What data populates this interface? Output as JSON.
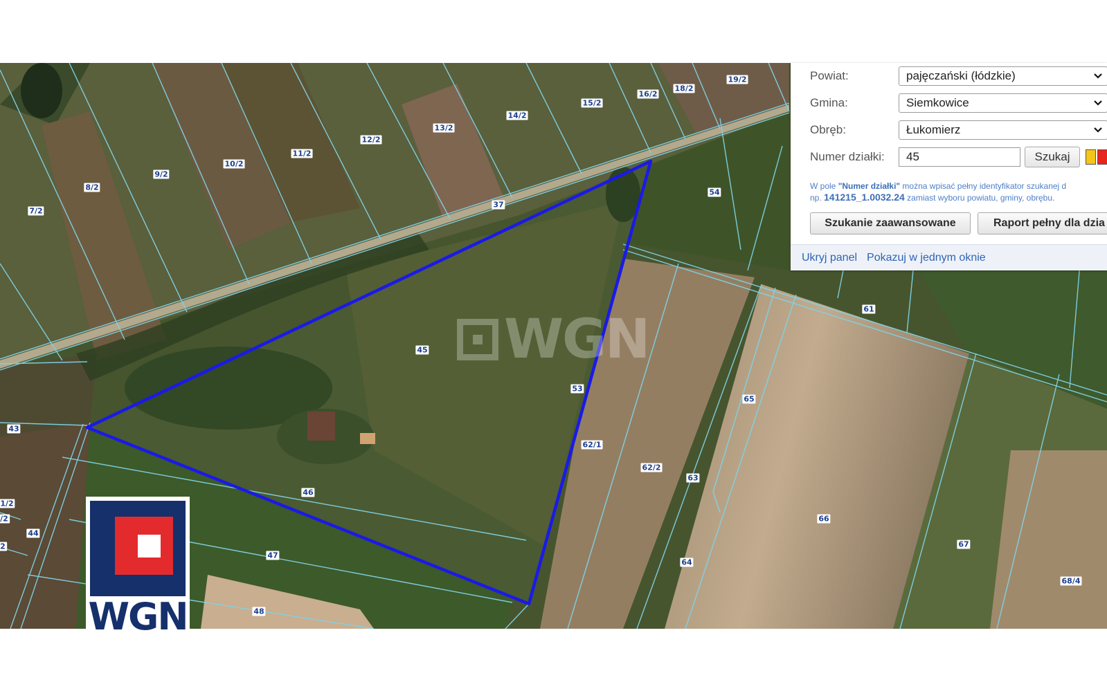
{
  "panel": {
    "powiat_label": "Powiat:",
    "powiat_value": "pajęczański (łódzkie)",
    "gmina_label": "Gmina:",
    "gmina_value": "Siemkowice",
    "obreb_label": "Obręb:",
    "obreb_value": "Łukomierz",
    "numer_label": "Numer działki:",
    "numer_value": "45",
    "search_button": "Szukaj",
    "info_line1_pre": "W pole ",
    "info_line1_bold": "\"Numer działki\"",
    "info_line1_post": " można wpisać pełny identyfikator szukanej d",
    "info_line2_pre": "np. ",
    "info_line2_bold": "141215_1.0032.24",
    "info_line2_post": " zamiast wyboru powiatu, gminy, obrębu.",
    "advanced_button": "Szukanie zaawansowane",
    "report_button": "Raport pełny dla dzia",
    "hide_link": "Ukryj panel",
    "single_window_link": "Pokazuj w jednym oknie",
    "swatch_colors": [
      "#f5c518",
      "#e8261e"
    ]
  },
  "map": {
    "highlight_color": "#1a1ae6",
    "boundary_color": "#7fd3e6",
    "selected_parcel": "45",
    "parcel_labels": [
      "19/2",
      "18/2",
      "16/2",
      "15/2",
      "14/2",
      "13/2",
      "12/2",
      "11/2",
      "10/2",
      "9/2",
      "8/2",
      "7/2",
      "37",
      "54",
      "45",
      "53",
      "61",
      "65",
      "62/1",
      "62/2",
      "63",
      "66",
      "67",
      "68/4",
      "43",
      "46",
      "47",
      "48",
      "44",
      "64",
      "1/2",
      "/2",
      "2"
    ],
    "watermark": "WGN"
  },
  "logo": {
    "text": "WGN"
  }
}
